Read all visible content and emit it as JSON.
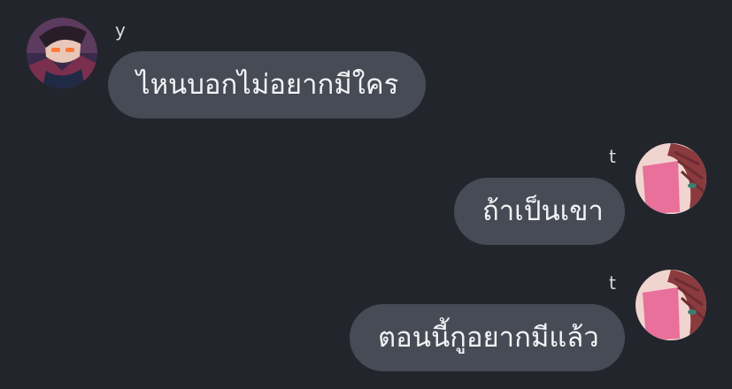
{
  "messages": [
    {
      "sender": "y",
      "text": "ไหนบอกไม่อยากมีใคร",
      "side": "left",
      "avatar": "avatar-y"
    },
    {
      "sender": "t",
      "text": "ถ้าเป็นเขา",
      "side": "right",
      "avatar": "avatar-t"
    },
    {
      "sender": "t",
      "text": "ตอนนี้กูอยากมีแล้ว",
      "side": "right",
      "avatar": "avatar-t"
    }
  ],
  "colors": {
    "background": "#23252c",
    "bubble": "#474b55",
    "text": "#f2f3f5",
    "name": "#d9dade"
  }
}
